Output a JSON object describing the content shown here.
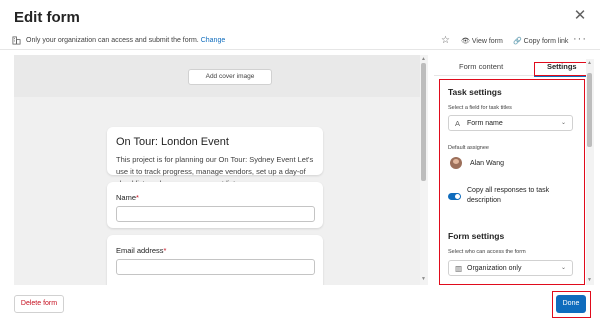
{
  "dialog": {
    "title": "Edit form",
    "close_glyph": "✕"
  },
  "infobar": {
    "message": "Only your organization can access and submit the form.",
    "change_link": "Change",
    "view_form": "View form",
    "copy_form_link": "Copy form link",
    "more_glyph": "···"
  },
  "form": {
    "cover_button": "Add cover image",
    "title": "On Tour: London Event",
    "description": "This project is for planning our On Tour: Sydney Event Let's use it to track progress, manage vendors, set up a day-of checklist, and manage our guest list.",
    "fields": [
      {
        "label": "Name",
        "required_mark": "*"
      },
      {
        "label": "Email address",
        "required_mark": "*"
      }
    ]
  },
  "panel": {
    "tabs": [
      {
        "label": "Form content",
        "selected": false
      },
      {
        "label": "Settings",
        "selected": true
      }
    ],
    "task_settings": {
      "heading": "Task settings",
      "title_field_label": "Select a field for task titles",
      "title_field_value": "Form name",
      "default_assignee_label": "Default assignee",
      "assignee_name": "Alan Wang",
      "copy_responses_label": "Copy all responses to task description",
      "copy_responses_on": true
    },
    "form_settings": {
      "heading": "Form settings",
      "access_label": "Select who can access the form",
      "access_value": "Organization only"
    }
  },
  "footer": {
    "delete_label": "Delete form",
    "done_label": "Done"
  },
  "colors": {
    "accent": "#0f6cbd",
    "danger": "#c50f1f",
    "highlight": "#e00b1c"
  }
}
